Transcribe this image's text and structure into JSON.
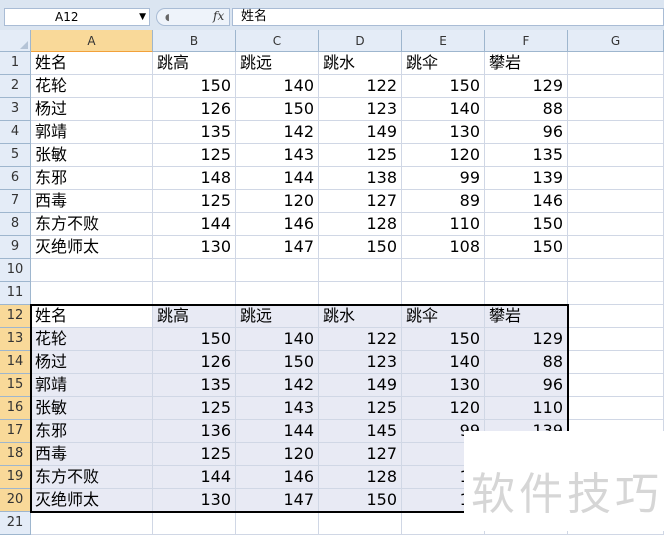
{
  "formula_bar": {
    "name_box": "A12",
    "fx_label": "fx",
    "formula": "姓名"
  },
  "columns": [
    "A",
    "B",
    "C",
    "D",
    "E",
    "F",
    "G"
  ],
  "active_column": "A",
  "rows": [
    {
      "num": "1",
      "cells": [
        "姓名",
        "跳高",
        "跳远",
        "跳水",
        "跳伞",
        "攀岩"
      ],
      "header": true
    },
    {
      "num": "2",
      "cells": [
        "花轮",
        "150",
        "140",
        "122",
        "150",
        "129"
      ]
    },
    {
      "num": "3",
      "cells": [
        "杨过",
        "126",
        "150",
        "123",
        "140",
        "88"
      ]
    },
    {
      "num": "4",
      "cells": [
        "郭靖",
        "135",
        "142",
        "149",
        "130",
        "96"
      ]
    },
    {
      "num": "5",
      "cells": [
        "张敏",
        "125",
        "143",
        "125",
        "120",
        "135"
      ]
    },
    {
      "num": "6",
      "cells": [
        "东邪",
        "148",
        "144",
        "138",
        "99",
        "139"
      ]
    },
    {
      "num": "7",
      "cells": [
        "西毒",
        "125",
        "120",
        "127",
        "89",
        "146"
      ]
    },
    {
      "num": "8",
      "cells": [
        "东方不败",
        "144",
        "146",
        "128",
        "110",
        "150"
      ]
    },
    {
      "num": "9",
      "cells": [
        "灭绝师太",
        "130",
        "147",
        "150",
        "108",
        "150"
      ]
    },
    {
      "num": "10",
      "cells": []
    },
    {
      "num": "11",
      "cells": []
    },
    {
      "num": "12",
      "cells": [
        "姓名",
        "跳高",
        "跳远",
        "跳水",
        "跳伞",
        "攀岩"
      ],
      "header": true,
      "selected": true
    },
    {
      "num": "13",
      "cells": [
        "花轮",
        "150",
        "140",
        "122",
        "150",
        "129"
      ],
      "selected": true
    },
    {
      "num": "14",
      "cells": [
        "杨过",
        "126",
        "150",
        "123",
        "140",
        "88"
      ],
      "selected": true
    },
    {
      "num": "15",
      "cells": [
        "郭靖",
        "135",
        "142",
        "149",
        "130",
        "96"
      ],
      "selected": true
    },
    {
      "num": "16",
      "cells": [
        "张敏",
        "125",
        "143",
        "125",
        "120",
        "110"
      ],
      "selected": true
    },
    {
      "num": "17",
      "cells": [
        "东邪",
        "136",
        "144",
        "145",
        "99",
        "139"
      ],
      "selected": true
    },
    {
      "num": "18",
      "cells": [
        "西毒",
        "125",
        "120",
        "127",
        "9",
        ""
      ],
      "selected": true
    },
    {
      "num": "19",
      "cells": [
        "东方不败",
        "144",
        "146",
        "128",
        "11",
        ""
      ],
      "selected": true
    },
    {
      "num": "20",
      "cells": [
        "灭绝师太",
        "130",
        "147",
        "150",
        "10",
        ""
      ],
      "selected": true
    },
    {
      "num": "21",
      "cells": []
    }
  ],
  "watermark": "软件技巧",
  "colors": {
    "header_bg": "#e4ecf7",
    "active_header_bg": "#f9d999",
    "selection_fill": "#e8eaf4",
    "grid": "#d0d7e5"
  }
}
